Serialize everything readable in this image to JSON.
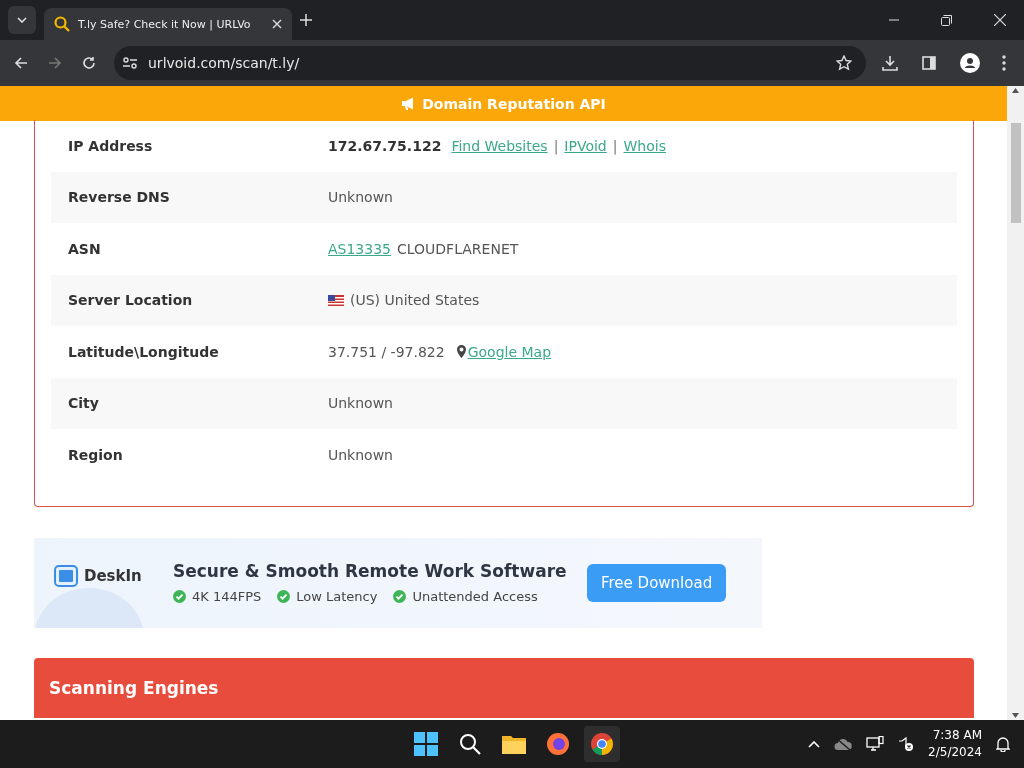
{
  "browser": {
    "tab_title": "T.ly Safe? Check it Now | URLVo",
    "url": "urlvoid.com/scan/t.ly/"
  },
  "banner": {
    "text": "Domain Reputation API"
  },
  "info_rows": [
    {
      "label": "IP Address",
      "value": [
        {
          "kind": "bold",
          "text": "172.67.75.122"
        },
        {
          "kind": "link",
          "text": "Find Websites"
        },
        {
          "kind": "sep",
          "text": "|"
        },
        {
          "kind": "link",
          "text": "IPVoid"
        },
        {
          "kind": "sep",
          "text": "|"
        },
        {
          "kind": "link",
          "text": "Whois"
        }
      ]
    },
    {
      "label": "Reverse DNS",
      "value": [
        {
          "kind": "text",
          "text": "Unknown"
        }
      ]
    },
    {
      "label": "ASN",
      "value": [
        {
          "kind": "link",
          "text": "AS13335"
        },
        {
          "kind": "text",
          "text": "CLOUDFLARENET"
        }
      ]
    },
    {
      "label": "Server Location",
      "value": [
        {
          "kind": "flag"
        },
        {
          "kind": "text",
          "text": "(US) United States"
        }
      ]
    },
    {
      "label": "Latitude\\Longitude",
      "value": [
        {
          "kind": "text",
          "text": "37.751 / -97.822"
        },
        {
          "kind": "pin"
        },
        {
          "kind": "link",
          "text": "Google Map"
        }
      ]
    },
    {
      "label": "City",
      "value": [
        {
          "kind": "text",
          "text": "Unknown"
        }
      ]
    },
    {
      "label": "Region",
      "value": [
        {
          "kind": "text",
          "text": "Unknown"
        }
      ]
    }
  ],
  "ad": {
    "brand": "DeskIn",
    "headline": "Secure & Smooth Remote Work Software",
    "features": [
      "4K 144FPS",
      "Low Latency",
      "Unattended Access"
    ],
    "button": "Free Download"
  },
  "section": {
    "title": "Scanning Engines"
  },
  "taskbar": {
    "time": "7:38 AM",
    "date": "2/5/2024"
  }
}
